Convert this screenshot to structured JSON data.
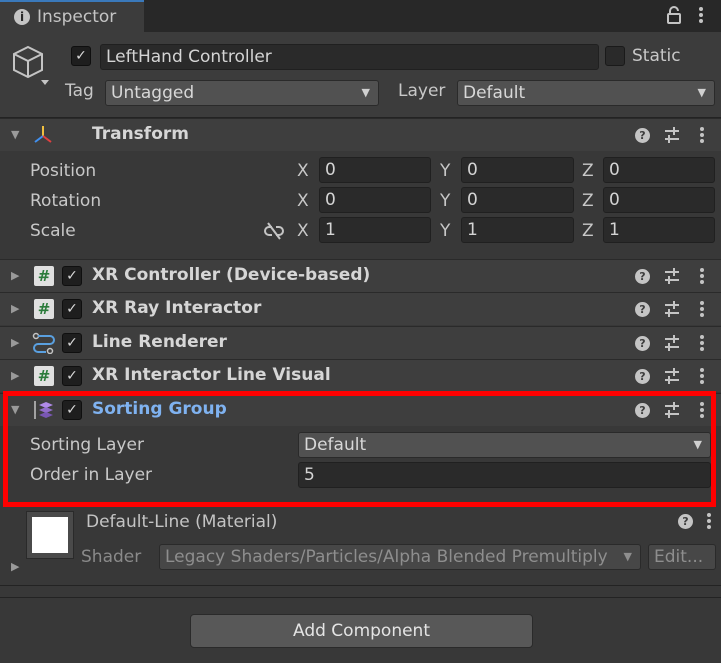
{
  "window": {
    "tab_label": "Inspector",
    "info_icon": "info-icon",
    "lock_icon": "lock-icon",
    "menu_icon": "kebab-menu-icon"
  },
  "gameobject": {
    "active": true,
    "name": "LeftHand Controller",
    "static_label": "Static",
    "static_checked": false,
    "tag_label": "Tag",
    "tag_value": "Untagged",
    "layer_label": "Layer",
    "layer_value": "Default"
  },
  "transform": {
    "title": "Transform",
    "rows": [
      {
        "label": "Position",
        "x": "0",
        "y": "0",
        "z": "0"
      },
      {
        "label": "Rotation",
        "x": "0",
        "y": "0",
        "z": "0"
      },
      {
        "label": "Scale",
        "x": "1",
        "y": "1",
        "z": "1"
      }
    ],
    "axis_x": "X",
    "axis_y": "Y",
    "axis_z": "Z"
  },
  "components": [
    {
      "title": "XR Controller (Device-based)",
      "icon": "script-hash-icon",
      "enabled": true
    },
    {
      "title": "XR Ray Interactor",
      "icon": "script-hash-icon",
      "enabled": true
    },
    {
      "title": "Line Renderer",
      "icon": "line-renderer-icon",
      "enabled": true
    },
    {
      "title": "XR Interactor Line Visual",
      "icon": "script-hash-icon",
      "enabled": true
    }
  ],
  "sorting_group": {
    "title": "Sorting Group",
    "enabled": true,
    "sorting_layer_label": "Sorting Layer",
    "sorting_layer_value": "Default",
    "order_label": "Order in Layer",
    "order_value": "5"
  },
  "material": {
    "title": "Default-Line (Material)",
    "shader_label": "Shader",
    "shader_value": "Legacy Shaders/Particles/Alpha Blended Premultiply",
    "edit_label": "Edit..."
  },
  "add_component_label": "Add Component",
  "colors": {
    "highlight": "#ff0000",
    "accent_title": "#7fb2f0",
    "tab_accent": "#3a79bb"
  }
}
